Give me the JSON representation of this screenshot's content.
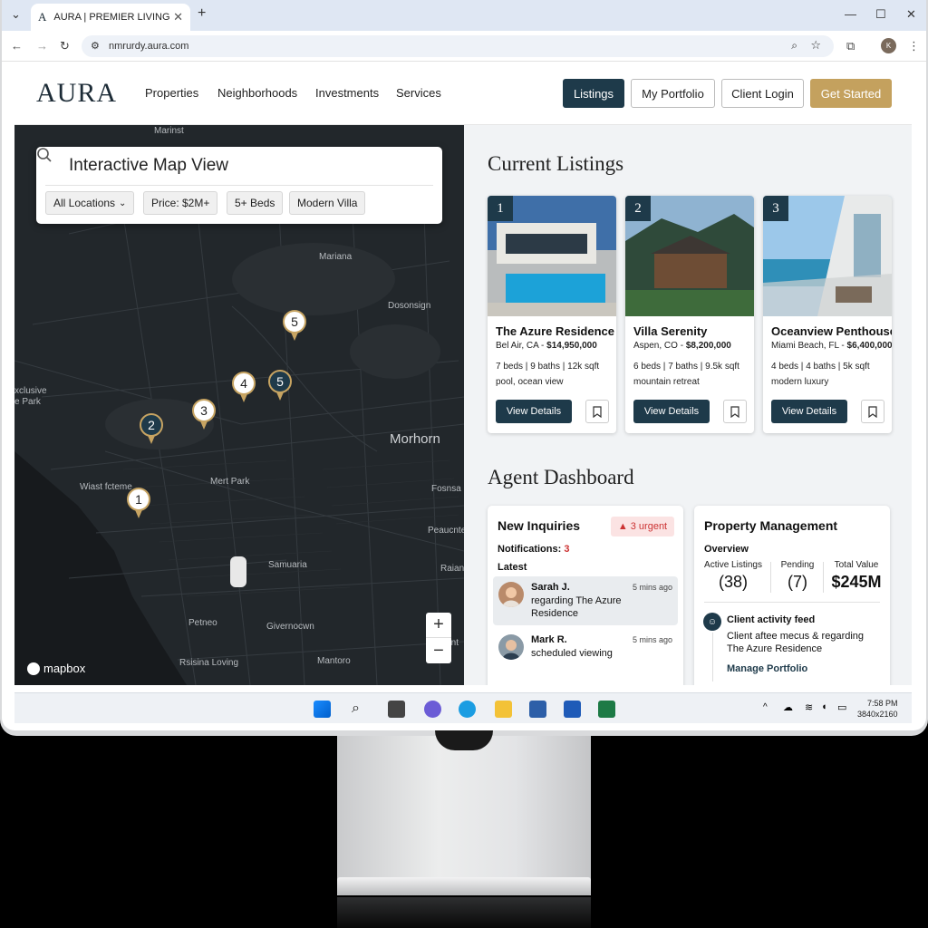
{
  "browser": {
    "tab_title": "AURA | PREMIER LIVING",
    "tab_favicon": "A",
    "url": "nmrurdy.aura.com",
    "profile_initial": "K"
  },
  "site": {
    "logo": "AURA",
    "nav": [
      "Properties",
      "Neighborhoods",
      "Investments",
      "Services"
    ],
    "buttons": {
      "listings": "Listings",
      "portfolio": "My Portfolio",
      "login": "Client Login",
      "started": "Get Started"
    }
  },
  "map": {
    "search_title": "Interactive Map View",
    "filters": [
      "All Locations",
      "Price: $2M+",
      "5+ Beds",
      "Modern Villa"
    ],
    "labels": [
      "Mariana",
      "Dosonsign",
      "xclusive",
      "e Park",
      "Morhorn",
      "Mert Park",
      "Wiast fcteme",
      "Samuaria",
      "Peaucnte",
      "Raian",
      "Petneo",
      "Givernocwn",
      "Rsisina Loving",
      "Mantoro",
      "Marinst",
      "Fosnsa",
      "Rsisint"
    ],
    "pins": [
      {
        "label": "5",
        "style": "light"
      },
      {
        "label": "4",
        "style": "light"
      },
      {
        "label": "5",
        "style": "dark"
      },
      {
        "label": "3",
        "style": "light"
      },
      {
        "label": "2",
        "style": "dark"
      },
      {
        "label": "1",
        "style": "light"
      }
    ],
    "zoom_in": "+",
    "zoom_out": "−",
    "attribution": "mapbox"
  },
  "listings": {
    "title": "Current Listings",
    "items": [
      {
        "num": "1",
        "name": "The Azure Residence",
        "location": "Bel Air, CA - ",
        "price": "$14,950,000",
        "beds": "7 beds",
        "baths": "9 baths",
        "sqft": "12k sqft",
        "desc": "pool, ocean view",
        "button": "View Details"
      },
      {
        "num": "2",
        "name": "Villa Serenity",
        "location": "Aspen, CO - ",
        "price": "$8,200,000",
        "beds": "6 beds",
        "baths": "7 baths",
        "sqft": "9.5k sqft",
        "desc": "mountain retreat",
        "button": "View Details"
      },
      {
        "num": "3",
        "name": "Oceanview Penthouse",
        "location": "Miami Beach, FL - ",
        "price": "$6,400,000",
        "beds": "4 beds",
        "baths": "4 baths",
        "sqft": "5k sqft",
        "desc": "modern luxury",
        "button": "View Details"
      }
    ]
  },
  "dashboard": {
    "title": "Agent Dashboard",
    "inquiries": {
      "title": "New Inquiries",
      "urgent": "3 urgent",
      "notifications_label": "Notifications: ",
      "notifications_count": "3",
      "latest_label": "Latest",
      "messages": [
        {
          "name": "Sarah J.",
          "text": "regarding The Azure Residence",
          "time": "5 mins ago"
        },
        {
          "name": "Mark R.",
          "text": "scheduled viewing",
          "time": "5 mins ago"
        }
      ]
    },
    "management": {
      "title": "Property Management",
      "overview": "Overview",
      "stats": [
        {
          "label": "Active Listings",
          "value": "(38)"
        },
        {
          "label": "Pending",
          "value": "(7)"
        },
        {
          "label": "Total Value",
          "value": "$245M"
        }
      ],
      "feed_title": "Client activity feed",
      "feed_text": "Client aftee mecus & regarding The Azure Residence",
      "feed_link": "Manage Portfolio"
    }
  },
  "taskbar": {
    "time": "7:58 PM",
    "resolution": "3840x2160"
  },
  "colors": {
    "navy": "#1e3a4a",
    "gold": "#c4a15e",
    "urgent": "#cc3333"
  }
}
